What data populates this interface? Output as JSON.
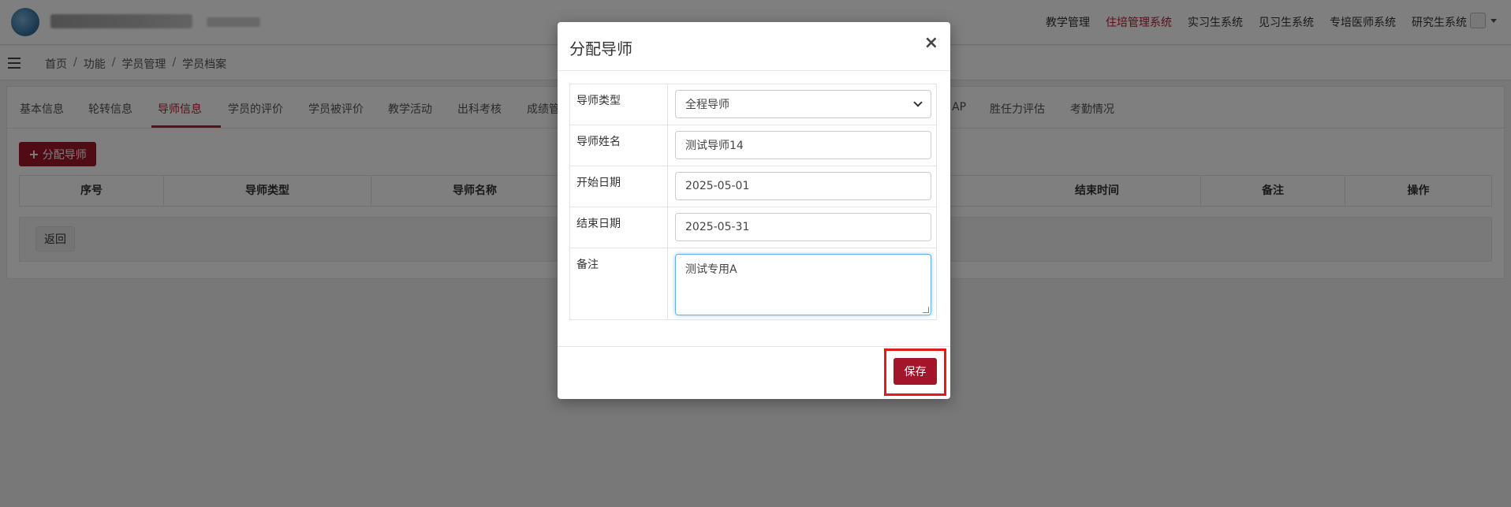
{
  "topnav": {
    "items": [
      "教学管理",
      "住培管理系统",
      "实习生系统",
      "见习生系统",
      "专培医师系统",
      "研究生系统"
    ],
    "active_index": 1
  },
  "breadcrumb": [
    "首页",
    "功能",
    "学员管理",
    "学员档案"
  ],
  "tabs": {
    "items": [
      "基本信息",
      "轮转信息",
      "导师信息",
      "学员的评价",
      "学员被评价",
      "教学活动",
      "出科考核",
      "成绩管",
      "AP",
      "胜任力评估",
      "考勤情况"
    ],
    "active_index": 2
  },
  "toolbar": {
    "assign_label": "分配导师"
  },
  "table": {
    "headers": [
      "序号",
      "导师类型",
      "导师名称",
      "结束时间",
      "备注",
      "操作"
    ]
  },
  "footer": {
    "back_label": "返回"
  },
  "modal": {
    "title": "分配导师",
    "close": "×",
    "fields": {
      "type_label": "导师类型",
      "type_value": "全程导师",
      "name_label": "导师姓名",
      "name_value": "测试导师14",
      "start_label": "开始日期",
      "start_value": "2025-05-01",
      "end_label": "结束日期",
      "end_value": "2025-05-31",
      "note_label": "备注",
      "note_value": "测试专用A"
    },
    "save_label": "保存"
  },
  "colors": {
    "accent": "#a3162a",
    "active_text": "#b32030",
    "highlight_box": "#e01b1b"
  }
}
